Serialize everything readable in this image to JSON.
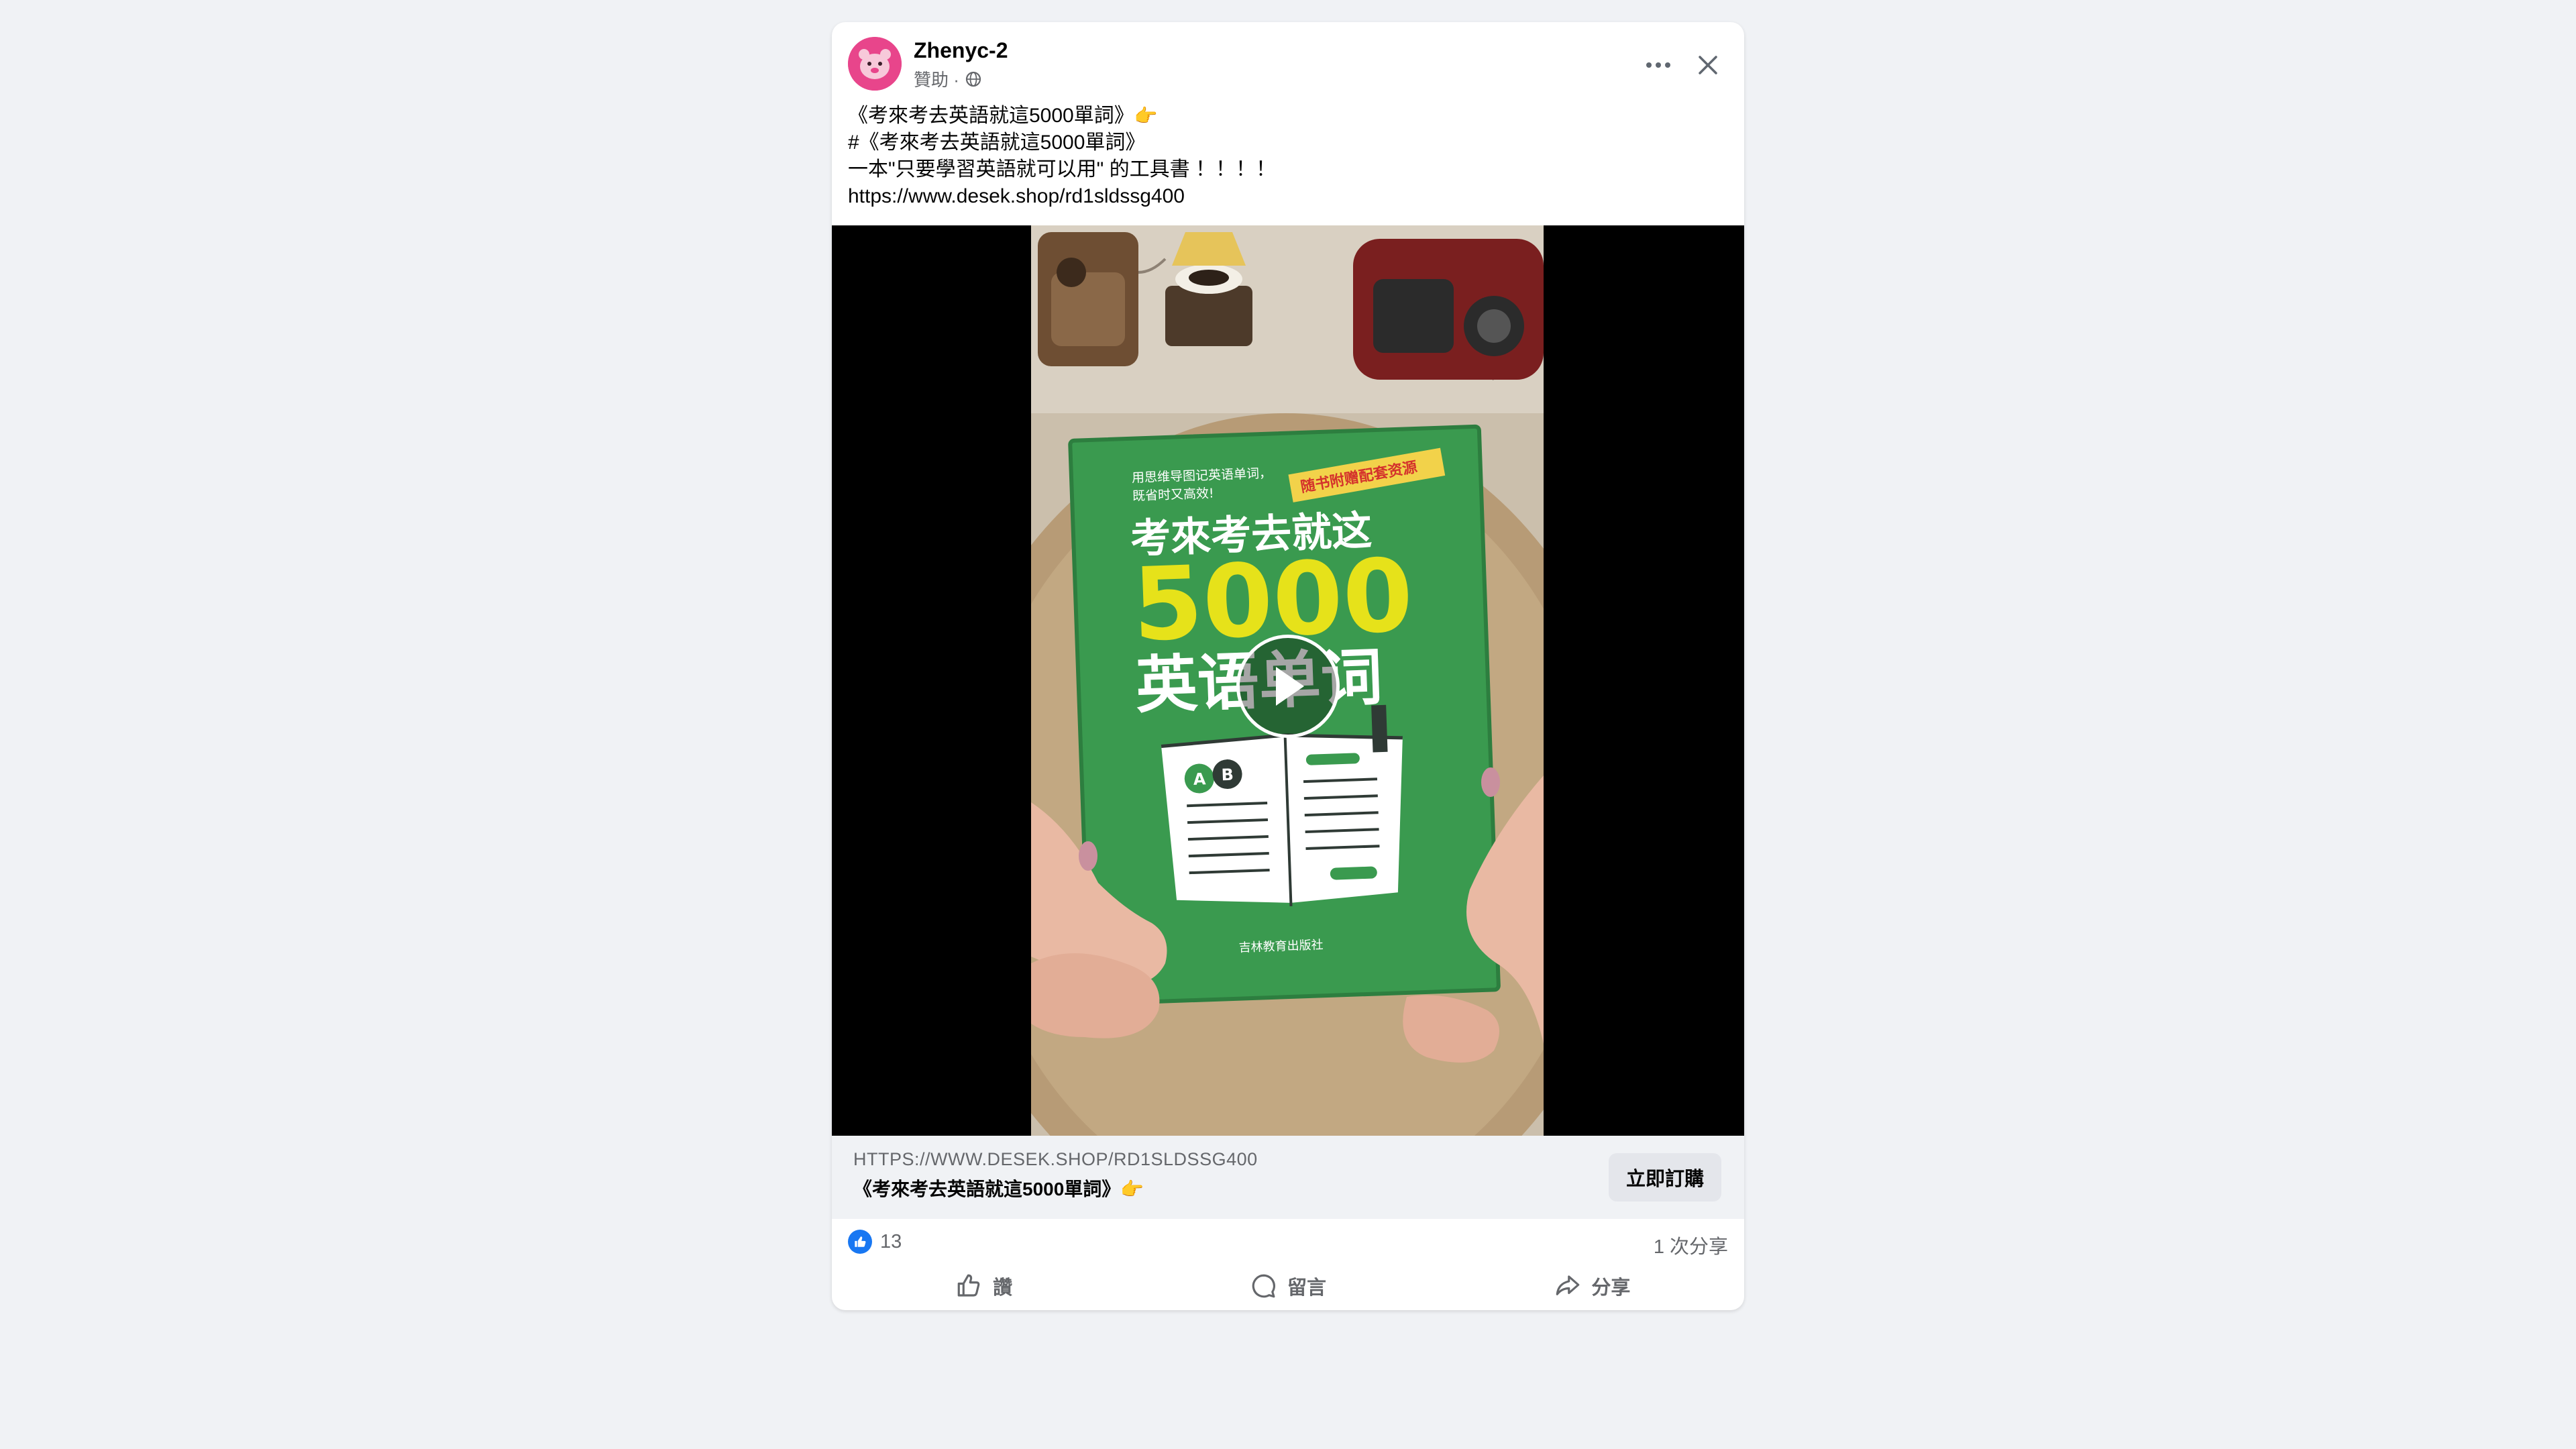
{
  "post": {
    "page_name": "Zhenyc-2",
    "sponsored_label": "贊助 ·",
    "caption_lines": [
      "《考來考去英語就這5000單詞》",
      "#《考來考去英語就這5000單詞》",
      "一本\"只要學習英語就可以用\" 的工具書 ！！！！",
      "https://www.desek.shop/rd1sldssg400"
    ],
    "pointing_emoji": "👉"
  },
  "video": {
    "book_cover": {
      "tagline_line1": "用思维导图记英语单词，",
      "tagline_line2": "既省时又高效!",
      "ribbon": "随书附赠配套资源",
      "title_line1": "考來考去就这",
      "title_number": "5000",
      "title_line2": "英语单词",
      "bubble_a": "A",
      "bubble_b": "B",
      "publisher": "吉林教育出版社"
    }
  },
  "link_preview": {
    "domain": "HTTPS://WWW.DESEK.SHOP/RD1SLDSSG400",
    "title": "《考來考去英語就這5000單詞》",
    "cta_label": "立即訂購"
  },
  "engagement": {
    "like_count": "13",
    "share_count": "1 次分享"
  },
  "actions": {
    "like": "讚",
    "comment": "留言",
    "share": "分享"
  },
  "colors": {
    "accent": "#1877f2",
    "cover_green": "#3a9a4f",
    "title_yellow": "#e6e21a",
    "avatar_pink": "#e8458b"
  }
}
